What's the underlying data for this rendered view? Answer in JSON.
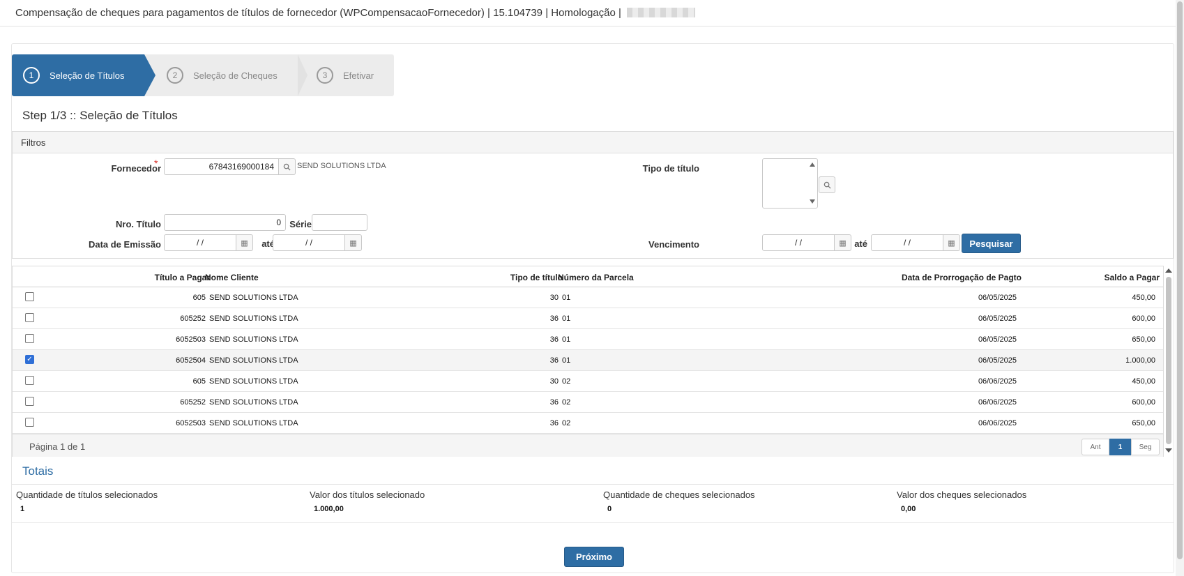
{
  "window": {
    "title": "Compensação de cheques para pagamentos de títulos de fornecedor (WPCompensacaoFornecedor) | 15.104739 | Homologação |"
  },
  "wizard": {
    "steps": [
      {
        "num": "1",
        "label": "Seleção de Títulos"
      },
      {
        "num": "2",
        "label": "Seleção de Cheques"
      },
      {
        "num": "3",
        "label": "Efetivar"
      }
    ],
    "step_heading": "Step 1/3 :: Seleção de Títulos"
  },
  "filters": {
    "header": "Filtros",
    "fornecedor_label": "Fornecedor",
    "required_mark": "*",
    "fornecedor_value": "67843169000184",
    "fornecedor_name": "SEND SOLUTIONS LTDA",
    "tipo_titulo_label": "Tipo de título",
    "nro_titulo_label": "Nro. Título",
    "nro_titulo_value": "0",
    "serie_label": "Série",
    "serie_value": "",
    "data_emissao_label": "Data de Emissão",
    "date_placeholder": "  /  /",
    "ate_label": "até",
    "vencimento_label": "Vencimento",
    "search_button": "Pesquisar"
  },
  "grid": {
    "columns": [
      "Título a Pagar",
      "Nome Cliente",
      "Tipo de título",
      "Número da Parcela",
      "Data de Prorrogação de Pagto",
      "Saldo a Pagar"
    ],
    "rows": [
      {
        "checked": false,
        "titulo": "605",
        "nome": "SEND SOLUTIONS LTDA",
        "tipo": "30",
        "parcela": "01",
        "data": "06/05/2025",
        "saldo": "450,00"
      },
      {
        "checked": false,
        "titulo": "605252",
        "nome": "SEND SOLUTIONS LTDA",
        "tipo": "36",
        "parcela": "01",
        "data": "06/05/2025",
        "saldo": "600,00"
      },
      {
        "checked": false,
        "titulo": "6052503",
        "nome": "SEND SOLUTIONS LTDA",
        "tipo": "36",
        "parcela": "01",
        "data": "06/05/2025",
        "saldo": "650,00"
      },
      {
        "checked": true,
        "titulo": "6052504",
        "nome": "SEND SOLUTIONS LTDA",
        "tipo": "36",
        "parcela": "01",
        "data": "06/05/2025",
        "saldo": "1.000,00"
      },
      {
        "checked": false,
        "titulo": "605",
        "nome": "SEND SOLUTIONS LTDA",
        "tipo": "30",
        "parcela": "02",
        "data": "06/06/2025",
        "saldo": "450,00"
      },
      {
        "checked": false,
        "titulo": "605252",
        "nome": "SEND SOLUTIONS LTDA",
        "tipo": "36",
        "parcela": "02",
        "data": "06/06/2025",
        "saldo": "600,00"
      },
      {
        "checked": false,
        "titulo": "6052503",
        "nome": "SEND SOLUTIONS LTDA",
        "tipo": "36",
        "parcela": "02",
        "data": "06/06/2025",
        "saldo": "650,00"
      }
    ],
    "page_info": "Página 1 de 1",
    "pager": {
      "prev": "Ant",
      "current": "1",
      "next": "Seg"
    }
  },
  "totais": {
    "title": "Totais",
    "items": [
      {
        "label": "Quantidade de títulos selecionados",
        "value": "1"
      },
      {
        "label": "Valor dos títulos selecionado",
        "value": "1.000,00"
      },
      {
        "label": "Quantidade de cheques selecionados",
        "value": "0"
      },
      {
        "label": "Valor dos cheques selecionados",
        "value": "0,00"
      }
    ]
  },
  "footer": {
    "next_button": "Próximo"
  },
  "colors": {
    "primary": "#2e6da4",
    "required": "#d9302a"
  }
}
